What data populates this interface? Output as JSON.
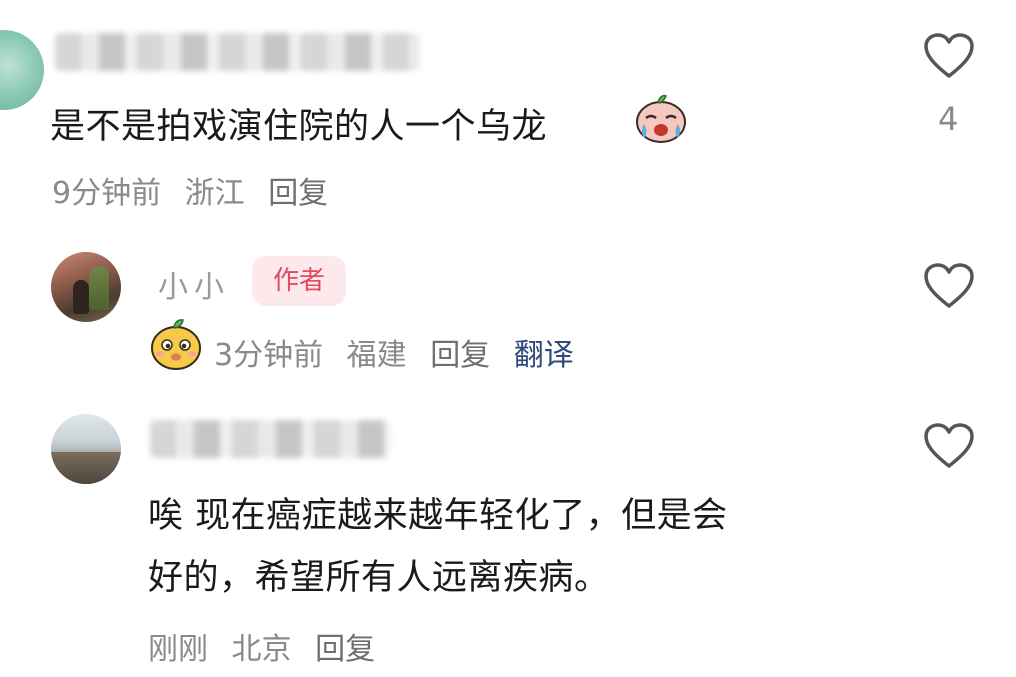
{
  "comments": [
    {
      "username": "",
      "text": "是不是拍戏演住院的人一个乌龙",
      "time": "9分钟前",
      "location": "浙江",
      "reply_label": "回复",
      "likes": "4",
      "emoji": "crying-face-icon"
    },
    {
      "username": "小小",
      "badge": "作者",
      "time": "3分钟前",
      "location": "福建",
      "reply_label": "回复",
      "translate_label": "翻译",
      "sticker": "mango-sticker-icon"
    },
    {
      "username": "",
      "text_line1": "唉 现在癌症越来越年轻化了，但是会",
      "text_line2": "好的，希望所有人远离疾病。",
      "time": "刚刚",
      "location": "北京",
      "reply_label": "回复"
    }
  ],
  "colors": {
    "text": "#1a1a1a",
    "meta": "#8a8a8a",
    "badge_bg": "#fde9ec",
    "badge_text": "#e24a5f",
    "translate": "#2d4a7a",
    "heart_stroke": "#555555"
  }
}
